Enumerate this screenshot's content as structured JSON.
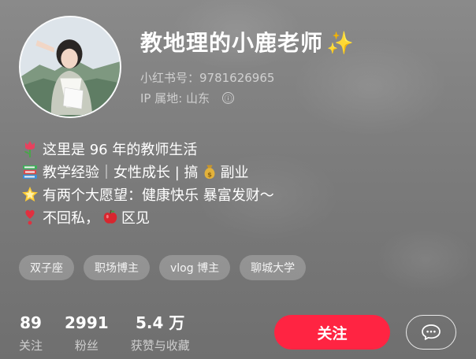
{
  "profile": {
    "name": "教地理的小鹿老师",
    "sparkle": "✨",
    "red_id": "小红书号：9781626965",
    "ip": "IP 属地: 山东",
    "info_icon": "ⓘ"
  },
  "bio": {
    "line1": "这里是 96 年的教师生活",
    "line2a": "教学经验｜女性成长 | 搞",
    "line2b": "副业",
    "line3": "有两个大愿望：健康快乐 暴富发财～",
    "line4a": "不回私，",
    "line4b": "区见",
    "emoji_icons": [
      "tulip-icon",
      "books-icon",
      "money-bag-icon",
      "star-icon",
      "heart-exclamation-icon",
      "apple-icon"
    ]
  },
  "tags": [
    "双子座",
    "职场博主",
    "vlog 博主",
    "聊城大学"
  ],
  "stats": [
    {
      "num": "89",
      "label": "关注"
    },
    {
      "num": "2991",
      "label": "粉丝"
    },
    {
      "num": "5.4 万",
      "label": "获赞与收藏"
    }
  ],
  "actions": {
    "follow": "关注",
    "chat_icon": "chat-bubble-icon"
  },
  "colors": {
    "accent": "#ff2442",
    "background": "#7b7b7b",
    "sparkle": "#ffd84a"
  }
}
